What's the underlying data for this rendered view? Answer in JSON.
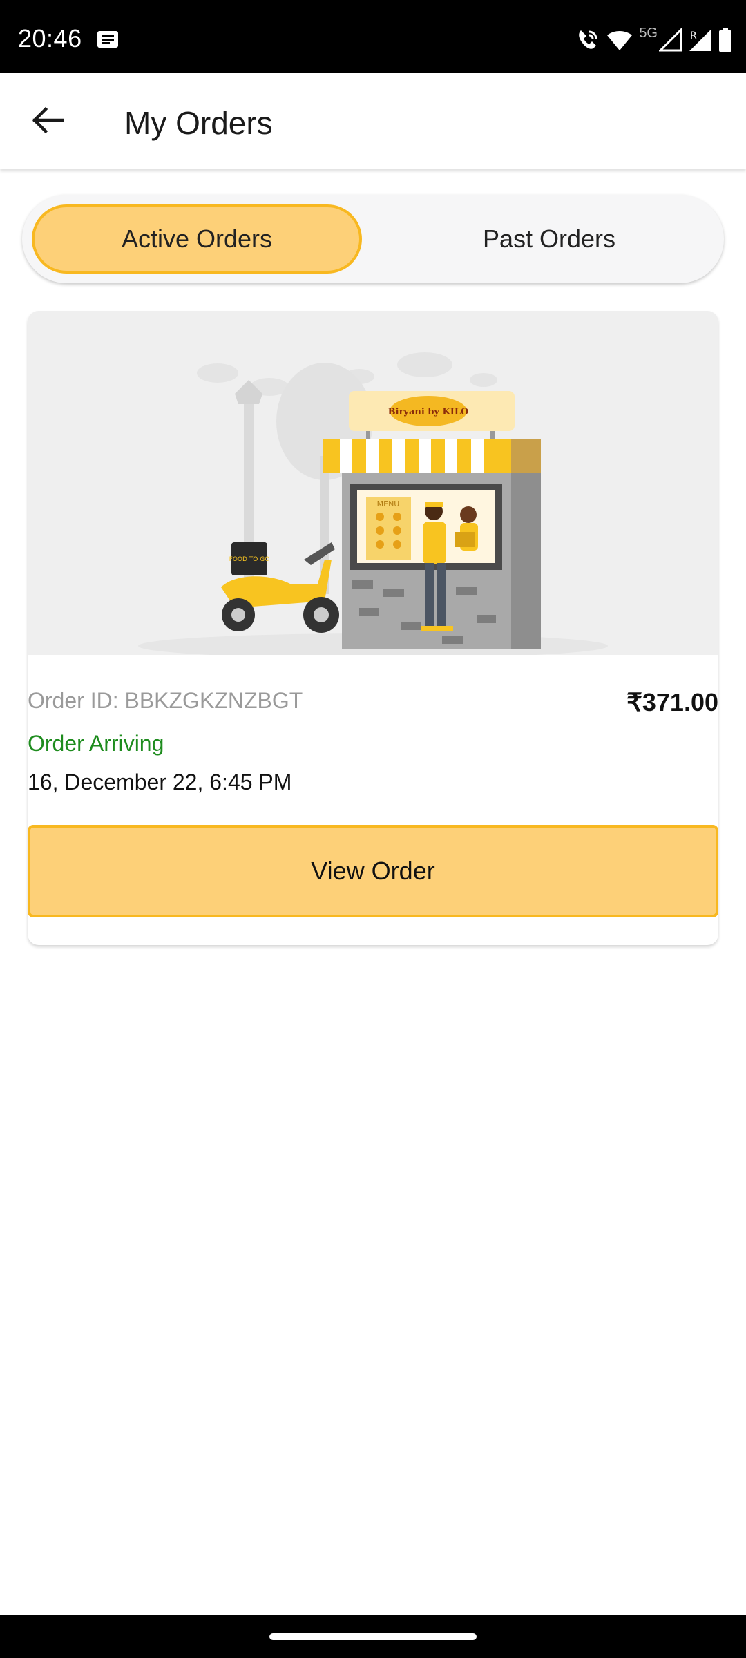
{
  "status_bar": {
    "time": "20:46",
    "network_label": "5G",
    "icons": [
      "message-icon",
      "wifi-calling-icon",
      "wifi-icon",
      "signal-icon",
      "roaming-signal-icon",
      "battery-icon"
    ]
  },
  "header": {
    "title": "My Orders",
    "back_icon": "arrow-left-icon"
  },
  "tabs": [
    {
      "label": "Active Orders",
      "active": true
    },
    {
      "label": "Past Orders",
      "active": false
    }
  ],
  "order": {
    "image": "shop-delivery-illustration",
    "brand_logo_text": "Biryani by KILO",
    "menu_board_text": "MENU",
    "scooter_box_text": "FOOD TO GO",
    "order_id": "Order ID: BBKZGKZNZBGT",
    "price": "₹371.00",
    "status": "Order Arriving",
    "datetime": "16, December 22, 6:45 PM",
    "button_label": "View Order"
  },
  "colors": {
    "accent_fill": "#fdd078",
    "accent_border": "#f8b820",
    "status_green": "#1e8c1e"
  }
}
